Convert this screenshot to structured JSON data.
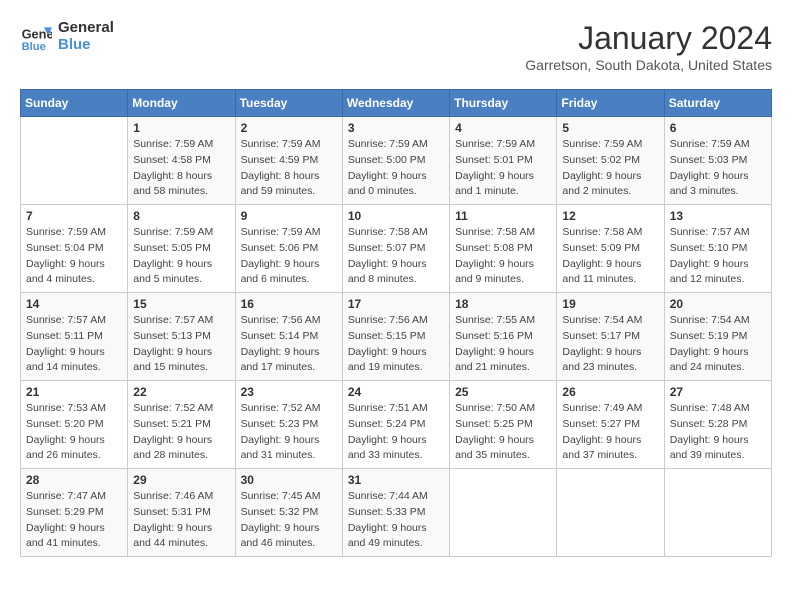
{
  "header": {
    "logo_line1": "General",
    "logo_line2": "Blue",
    "title": "January 2024",
    "subtitle": "Garretson, South Dakota, United States"
  },
  "calendar": {
    "days_of_week": [
      "Sunday",
      "Monday",
      "Tuesday",
      "Wednesday",
      "Thursday",
      "Friday",
      "Saturday"
    ],
    "weeks": [
      [
        {
          "day": "",
          "detail": ""
        },
        {
          "day": "1",
          "detail": "Sunrise: 7:59 AM\nSunset: 4:58 PM\nDaylight: 8 hours\nand 58 minutes."
        },
        {
          "day": "2",
          "detail": "Sunrise: 7:59 AM\nSunset: 4:59 PM\nDaylight: 8 hours\nand 59 minutes."
        },
        {
          "day": "3",
          "detail": "Sunrise: 7:59 AM\nSunset: 5:00 PM\nDaylight: 9 hours\nand 0 minutes."
        },
        {
          "day": "4",
          "detail": "Sunrise: 7:59 AM\nSunset: 5:01 PM\nDaylight: 9 hours\nand 1 minute."
        },
        {
          "day": "5",
          "detail": "Sunrise: 7:59 AM\nSunset: 5:02 PM\nDaylight: 9 hours\nand 2 minutes."
        },
        {
          "day": "6",
          "detail": "Sunrise: 7:59 AM\nSunset: 5:03 PM\nDaylight: 9 hours\nand 3 minutes."
        }
      ],
      [
        {
          "day": "7",
          "detail": "Sunrise: 7:59 AM\nSunset: 5:04 PM\nDaylight: 9 hours\nand 4 minutes."
        },
        {
          "day": "8",
          "detail": "Sunrise: 7:59 AM\nSunset: 5:05 PM\nDaylight: 9 hours\nand 5 minutes."
        },
        {
          "day": "9",
          "detail": "Sunrise: 7:59 AM\nSunset: 5:06 PM\nDaylight: 9 hours\nand 6 minutes."
        },
        {
          "day": "10",
          "detail": "Sunrise: 7:58 AM\nSunset: 5:07 PM\nDaylight: 9 hours\nand 8 minutes."
        },
        {
          "day": "11",
          "detail": "Sunrise: 7:58 AM\nSunset: 5:08 PM\nDaylight: 9 hours\nand 9 minutes."
        },
        {
          "day": "12",
          "detail": "Sunrise: 7:58 AM\nSunset: 5:09 PM\nDaylight: 9 hours\nand 11 minutes."
        },
        {
          "day": "13",
          "detail": "Sunrise: 7:57 AM\nSunset: 5:10 PM\nDaylight: 9 hours\nand 12 minutes."
        }
      ],
      [
        {
          "day": "14",
          "detail": "Sunrise: 7:57 AM\nSunset: 5:11 PM\nDaylight: 9 hours\nand 14 minutes."
        },
        {
          "day": "15",
          "detail": "Sunrise: 7:57 AM\nSunset: 5:13 PM\nDaylight: 9 hours\nand 15 minutes."
        },
        {
          "day": "16",
          "detail": "Sunrise: 7:56 AM\nSunset: 5:14 PM\nDaylight: 9 hours\nand 17 minutes."
        },
        {
          "day": "17",
          "detail": "Sunrise: 7:56 AM\nSunset: 5:15 PM\nDaylight: 9 hours\nand 19 minutes."
        },
        {
          "day": "18",
          "detail": "Sunrise: 7:55 AM\nSunset: 5:16 PM\nDaylight: 9 hours\nand 21 minutes."
        },
        {
          "day": "19",
          "detail": "Sunrise: 7:54 AM\nSunset: 5:17 PM\nDaylight: 9 hours\nand 23 minutes."
        },
        {
          "day": "20",
          "detail": "Sunrise: 7:54 AM\nSunset: 5:19 PM\nDaylight: 9 hours\nand 24 minutes."
        }
      ],
      [
        {
          "day": "21",
          "detail": "Sunrise: 7:53 AM\nSunset: 5:20 PM\nDaylight: 9 hours\nand 26 minutes."
        },
        {
          "day": "22",
          "detail": "Sunrise: 7:52 AM\nSunset: 5:21 PM\nDaylight: 9 hours\nand 28 minutes."
        },
        {
          "day": "23",
          "detail": "Sunrise: 7:52 AM\nSunset: 5:23 PM\nDaylight: 9 hours\nand 31 minutes."
        },
        {
          "day": "24",
          "detail": "Sunrise: 7:51 AM\nSunset: 5:24 PM\nDaylight: 9 hours\nand 33 minutes."
        },
        {
          "day": "25",
          "detail": "Sunrise: 7:50 AM\nSunset: 5:25 PM\nDaylight: 9 hours\nand 35 minutes."
        },
        {
          "day": "26",
          "detail": "Sunrise: 7:49 AM\nSunset: 5:27 PM\nDaylight: 9 hours\nand 37 minutes."
        },
        {
          "day": "27",
          "detail": "Sunrise: 7:48 AM\nSunset: 5:28 PM\nDaylight: 9 hours\nand 39 minutes."
        }
      ],
      [
        {
          "day": "28",
          "detail": "Sunrise: 7:47 AM\nSunset: 5:29 PM\nDaylight: 9 hours\nand 41 minutes."
        },
        {
          "day": "29",
          "detail": "Sunrise: 7:46 AM\nSunset: 5:31 PM\nDaylight: 9 hours\nand 44 minutes."
        },
        {
          "day": "30",
          "detail": "Sunrise: 7:45 AM\nSunset: 5:32 PM\nDaylight: 9 hours\nand 46 minutes."
        },
        {
          "day": "31",
          "detail": "Sunrise: 7:44 AM\nSunset: 5:33 PM\nDaylight: 9 hours\nand 49 minutes."
        },
        {
          "day": "",
          "detail": ""
        },
        {
          "day": "",
          "detail": ""
        },
        {
          "day": "",
          "detail": ""
        }
      ]
    ]
  }
}
